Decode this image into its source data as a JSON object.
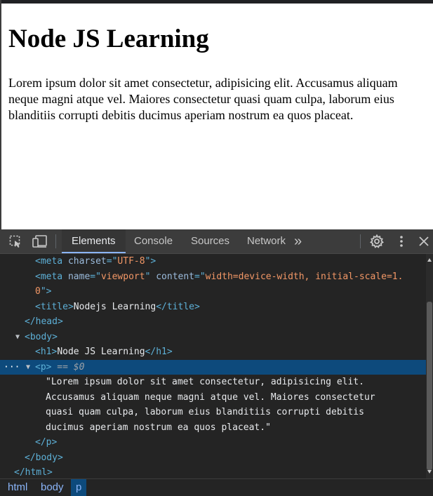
{
  "page": {
    "heading": "Node JS Learning",
    "paragraph": "Lorem ipsum dolor sit amet consectetur, adipisicing elit. Accusamus aliquam neque magni atque vel. Maiores consectetur quasi quam culpa, laborum eius blanditiis corrupti debitis ducimus aperiam nostrum ea quos placeat."
  },
  "devtools": {
    "tabs": [
      "Elements",
      "Console",
      "Sources",
      "Network"
    ],
    "active_tab": "Elements",
    "more_tabs": "»",
    "icons": [
      "inspect-element-icon",
      "device-toolbar-icon",
      "settings-gear-icon",
      "more-options-icon",
      "close-icon"
    ],
    "accent_color": "#8ab4f8",
    "selection_color": "#0d4a7c",
    "dom": {
      "meta_charset": {
        "open": "<meta ",
        "attr": "charset",
        "eq": "=\"",
        "value": "UTF-8",
        "close": "\">"
      },
      "meta_viewport_1": {
        "open": "<meta ",
        "attr1": "name",
        "eq1": "=\"",
        "value1": "viewport",
        "mid": "\" ",
        "attr2": "content",
        "eq2": "=\"",
        "value2": "width=device-width, initial-scale=1."
      },
      "meta_viewport_2": {
        "value": "0",
        "close": "\">"
      },
      "title": {
        "open": "<title>",
        "text": "Nodejs Learning",
        "close": "</title>"
      },
      "head_close": "</head>",
      "body_open": "<body>",
      "h1": {
        "open": "<h1>",
        "text": "Node JS Learning",
        "close": "</h1>"
      },
      "p_open": {
        "tag": "<p>",
        "marker": " == $0"
      },
      "p_text_lines": [
        "\"Lorem ipsum dolor sit amet consectetur, adipisicing elit.",
        "Accusamus aliquam neque magni atque vel. Maiores consectetur",
        "quasi quam culpa, laborum eius blanditiis corrupti debitis",
        "ducimus aperiam nostrum ea quos placeat.\""
      ],
      "p_close": "</p>",
      "body_close": "</body>",
      "html_close": "</html>"
    },
    "breadcrumbs": [
      "html",
      "body",
      "p"
    ],
    "active_breadcrumb": "p"
  }
}
